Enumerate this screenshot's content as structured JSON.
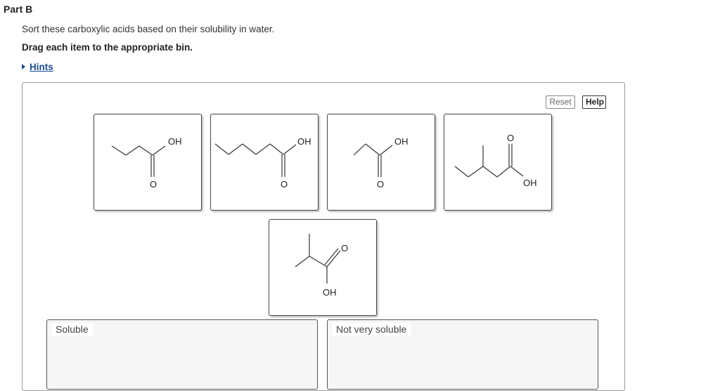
{
  "part": {
    "title": "Part B"
  },
  "instructions": {
    "text": "Sort these carboxylic acids based on their solubility in water.",
    "bold": "Drag each item to the appropriate bin."
  },
  "hints": {
    "label": "Hints"
  },
  "toolbar": {
    "reset_label": "Reset",
    "help_label": "Help"
  },
  "items": [
    {
      "name": "butanoic acid",
      "labels": {
        "oh": "OH",
        "o": "O"
      }
    },
    {
      "name": "hexanoic acid",
      "labels": {
        "oh": "OH",
        "o": "O"
      }
    },
    {
      "name": "propanoic acid",
      "labels": {
        "oh": "OH",
        "o": "O"
      }
    },
    {
      "name": "3-methylpentanoic acid",
      "labels": {
        "oh": "OH",
        "o": "O"
      }
    },
    {
      "name": "2-methylpropanoic acid",
      "labels": {
        "oh": "OH",
        "o": "O"
      }
    }
  ],
  "bins": [
    {
      "label": "Soluble"
    },
    {
      "label": "Not very soluble"
    }
  ]
}
